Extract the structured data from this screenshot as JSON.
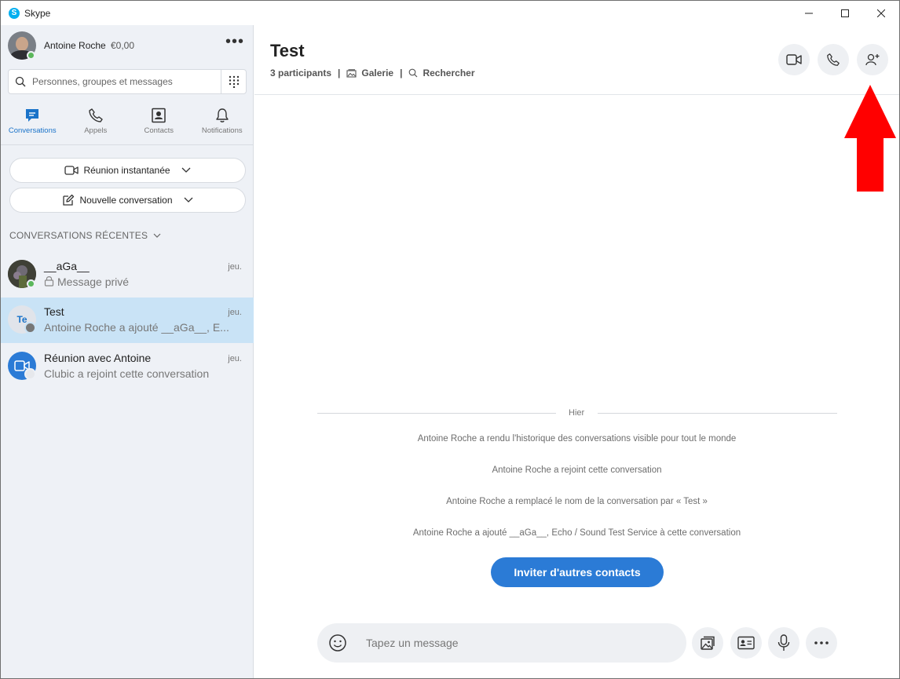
{
  "window": {
    "title": "Skype"
  },
  "profile": {
    "name": "Antoine Roche",
    "credit": "€0,00",
    "more": "•••"
  },
  "search": {
    "placeholder": "Personnes, groupes et messages"
  },
  "nav_tabs": [
    {
      "label": "Conversations",
      "icon": "chat-icon",
      "active": true
    },
    {
      "label": "Appels",
      "icon": "phone-icon"
    },
    {
      "label": "Contacts",
      "icon": "contacts-icon"
    },
    {
      "label": "Notifications",
      "icon": "bell-icon"
    }
  ],
  "actions": {
    "meet_now": "Réunion instantanée",
    "new_chat": "Nouvelle conversation"
  },
  "recent": {
    "header": "CONVERSATIONS RÉCENTES",
    "items": [
      {
        "name": "__aGa__",
        "subtitle": "Message privé",
        "time": "jeu."
      },
      {
        "name": "Test",
        "subtitle": "Antoine Roche a ajouté __aGa__, E...",
        "time": "jeu.",
        "initials": "Te",
        "selected": true
      },
      {
        "name": "Réunion avec Antoine",
        "subtitle": "Clubic a rejoint cette conversation",
        "time": "jeu."
      }
    ]
  },
  "chat": {
    "title": "Test",
    "participants": "3 participants",
    "gallery": "Galerie",
    "search": "Rechercher",
    "day": "Hier",
    "messages": [
      "Antoine Roche a rendu l'historique des conversations visible pour tout le monde",
      "Antoine Roche a rejoint cette conversation",
      "Antoine Roche a remplacé le nom de la conversation par « Test »",
      "Antoine Roche a ajouté __aGa__, Echo / Sound Test Service à cette conversation"
    ],
    "invite": "Inviter d'autres contacts",
    "composer_placeholder": "Tapez un message"
  },
  "colors": {
    "accent": "#2b7bd6",
    "selected": "#c9e3f6",
    "arrow": "#ff0000",
    "online": "#5bb75b"
  }
}
